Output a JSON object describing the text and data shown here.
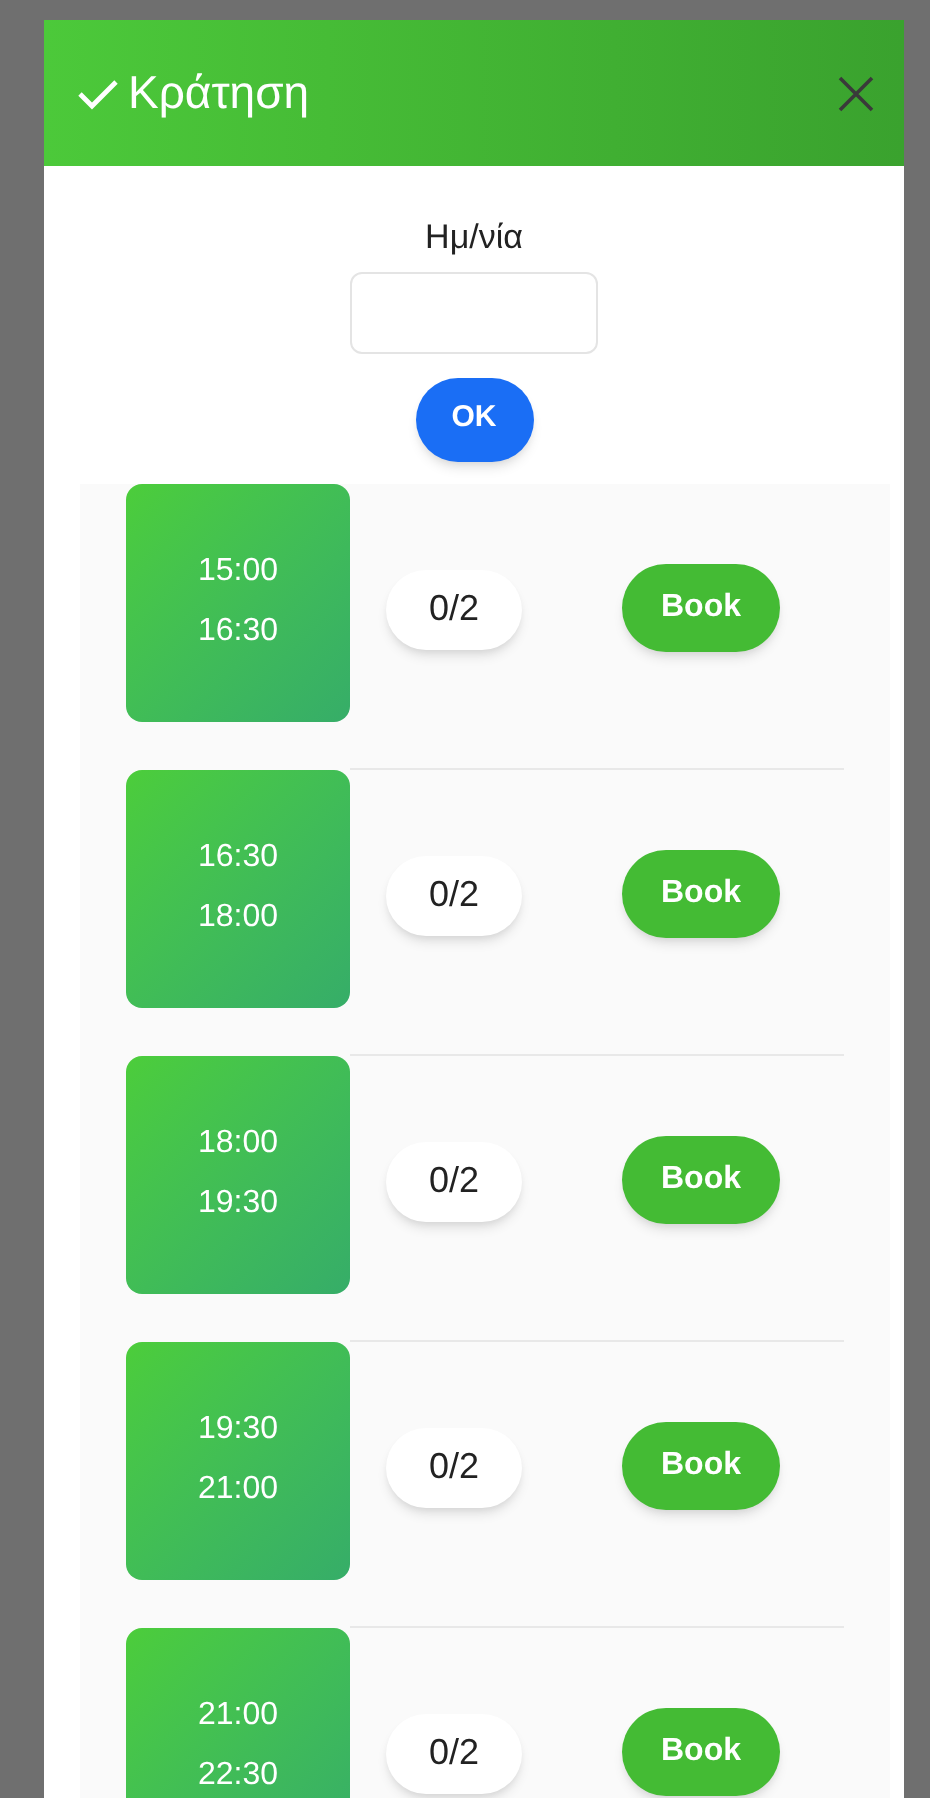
{
  "dialog": {
    "title": "Κράτηση"
  },
  "date_field": {
    "label": "Ημ/νία"
  },
  "ok_button": "OK",
  "slots": [
    {
      "start": "15:00",
      "end": "16:30",
      "occupancy": "0/2",
      "action": "Book"
    },
    {
      "start": "16:30",
      "end": "18:00",
      "occupancy": "0/2",
      "action": "Book"
    },
    {
      "start": "18:00",
      "end": "19:30",
      "occupancy": "0/2",
      "action": "Book"
    },
    {
      "start": "19:30",
      "end": "21:00",
      "occupancy": "0/2",
      "action": "Book"
    },
    {
      "start": "21:00",
      "end": "22:30",
      "occupancy": "0/2",
      "action": "Book"
    }
  ]
}
